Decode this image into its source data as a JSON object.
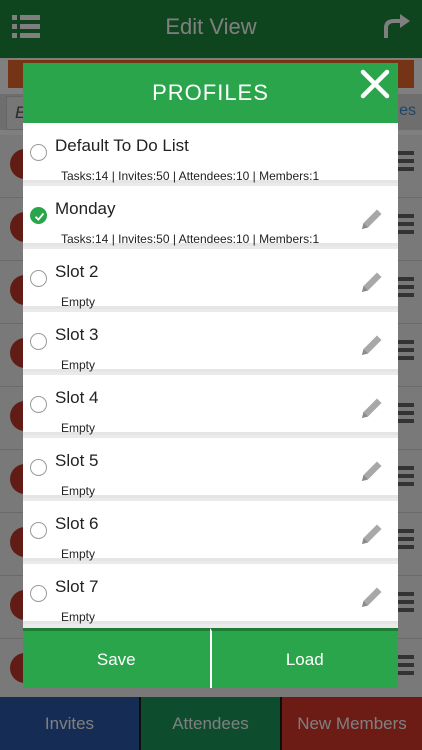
{
  "app": {
    "title": "Edit View",
    "search_text": "E",
    "search_right_text": "es",
    "icons": {
      "menu": "list-menu-icon",
      "share": "share-arrow-icon"
    },
    "colors": {
      "header": "#1f8b3d",
      "orange_bar": "#e8682b"
    }
  },
  "bottom_tabs": [
    {
      "label": "Invites",
      "color": "#2a5aa8"
    },
    {
      "label": "Attendees",
      "color": "#1a9a5a"
    },
    {
      "label": "New Members",
      "color": "#d9382a"
    }
  ],
  "modal": {
    "title": "PROFILES",
    "close_icon": "close-x-icon",
    "accent_color": "#2aa54b",
    "profiles": [
      {
        "name": "Default To Do List",
        "info": "Tasks:14 | Invites:50 | Attendees:10 | Members:1",
        "selected": false,
        "editable": false
      },
      {
        "name": "Monday",
        "info": "Tasks:14 | Invites:50 | Attendees:10 | Members:1",
        "selected": true,
        "editable": true
      },
      {
        "name": "Slot 2",
        "info": "Empty",
        "selected": false,
        "editable": true
      },
      {
        "name": "Slot 3",
        "info": "Empty",
        "selected": false,
        "editable": true
      },
      {
        "name": "Slot 4",
        "info": "Empty",
        "selected": false,
        "editable": true
      },
      {
        "name": "Slot 5",
        "info": "Empty",
        "selected": false,
        "editable": true
      },
      {
        "name": "Slot 6",
        "info": "Empty",
        "selected": false,
        "editable": true
      },
      {
        "name": "Slot 7",
        "info": "Empty",
        "selected": false,
        "editable": true
      }
    ],
    "footer": {
      "save_label": "Save",
      "load_label": "Load"
    }
  }
}
